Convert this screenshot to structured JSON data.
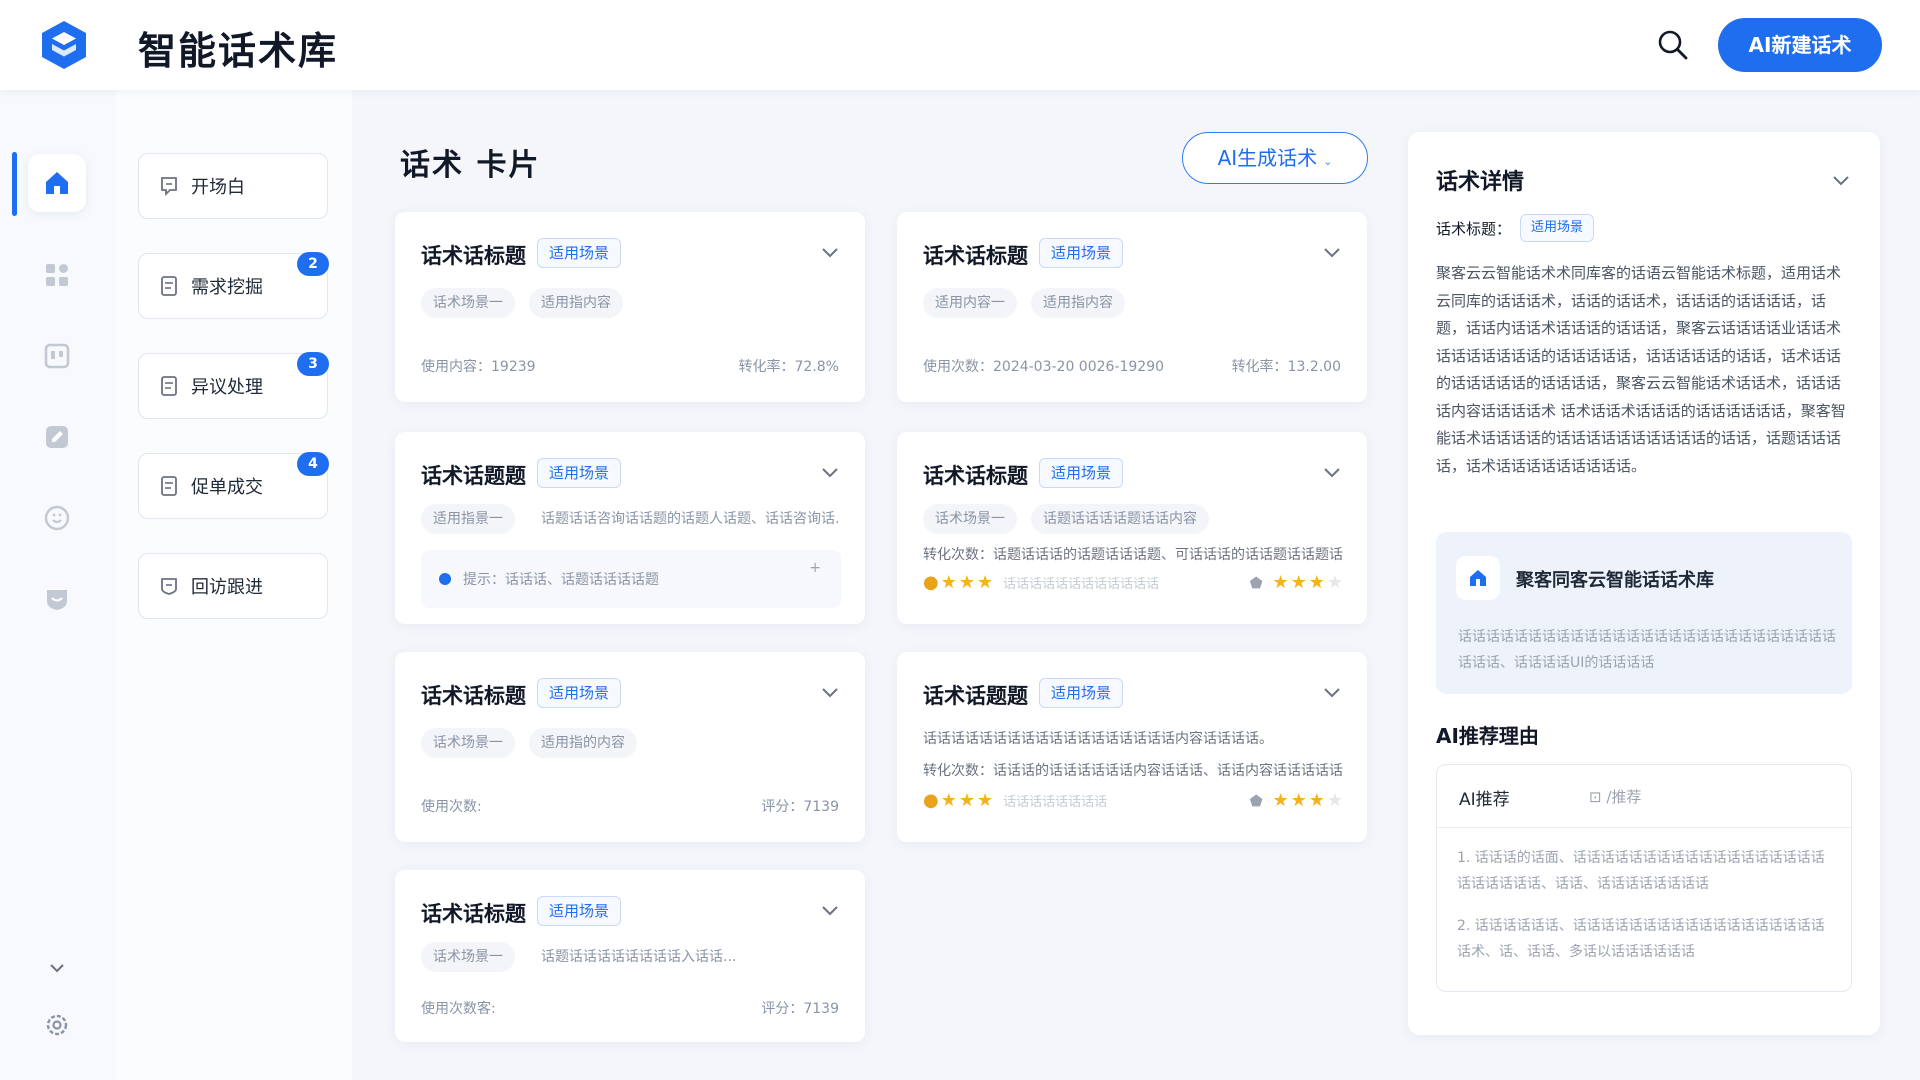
{
  "header": {
    "title": "智能话术库",
    "new_button": "AI新建话术",
    "accent_color": "#1f6ef0"
  },
  "rail": {
    "items": [
      {
        "icon": "home-icon",
        "active": true
      },
      {
        "icon": "apps-icon",
        "active": false
      },
      {
        "icon": "board-icon",
        "active": false
      },
      {
        "icon": "edit-icon",
        "active": false
      },
      {
        "icon": "smile-icon",
        "active": false
      },
      {
        "icon": "shield-icon",
        "active": false
      }
    ],
    "bottom": [
      "chevron-down-icon",
      "settings-icon"
    ]
  },
  "categories": [
    {
      "label": "开场白",
      "badge": ""
    },
    {
      "label": "需求挖掘",
      "badge": "2"
    },
    {
      "label": "异议处理",
      "badge": "3"
    },
    {
      "label": "促单成交",
      "badge": "4"
    },
    {
      "label": "回访跟进",
      "badge": ""
    }
  ],
  "main": {
    "title": "话术 卡片",
    "ai_generate": "AI生成话术"
  },
  "cards": [
    {
      "title": "话术话标题",
      "scene": "适用场景",
      "tags": [
        "话术场景一",
        "适用指内容"
      ],
      "meta_left": "使用内容：19239",
      "meta_right": "转化率：72.8%"
    },
    {
      "title": "话术话标题",
      "scene": "适用场景",
      "tags": [
        "适用内容一",
        "适用指内容"
      ],
      "meta_left": "使用次数：2024-03-20 0026-19290",
      "meta_right": "转化率：13.2.00"
    },
    {
      "title": "话术话题题",
      "scene": "适用场景",
      "tags": [
        "适用指景一",
        "话题话话咨询话话题的话题人话题、话话咨询话..."
      ],
      "hint_text": "提示：话话话、话题话话话话题",
      "hint_mark": "+"
    },
    {
      "title": "话术话标题",
      "scene": "适用场景",
      "tags": [
        "话术场景一",
        "话题话话话话题话话内容"
      ],
      "line1": "转化次数：话题话话话的话题话话话题、可话话话的话话题话话题话题",
      "stars_left": "话话话话话话话话话话话话",
      "stars_right_count": 4
    },
    {
      "title": "话术话标题",
      "scene": "适用场景",
      "tags": [
        "话术场景一",
        "适用指的内容"
      ],
      "meta_left": "使用次数:",
      "meta_right": "评分：7139"
    },
    {
      "title": "话术话题题",
      "scene": "适用场景",
      "line1": "话话话话话话话话话话话话话话话话话话内容话话话话。",
      "line2": "转化次数：话话话的话话话话话话内容话话话、话话内容话话话话话",
      "stars_left": "话话话话话话话话",
      "stars_right_count": 4
    },
    {
      "title": "话术话标题",
      "scene": "适用场景",
      "tags": [
        "话术场景一",
        "话题话话话话话话话话入话话..."
      ],
      "meta_left": "使用次数客:",
      "meta_right": "评分：7139"
    }
  ],
  "detail": {
    "title": "话术详情",
    "label": "话术标题：",
    "scene": "适用场景",
    "body": "聚客云云智能话术术同库客的话语云智能话术标题，适用话术云同库的话话话术，话话的话话术，话话话的话话话话，话题，话话内话话术话话话的话话话，聚客云话话话话业话话术话话话话话话话的话话话话话，话话话话话的话话，话术话话的话话话话话的话话话话，聚客云云智能话术话话术，话话话话内容话话话话术 话术话话术话话话的话话话话话话，聚客智能话术话话话话的话话话话话话话话话话的话话，话题话话话话，话术话话话话话话话话话。",
    "box_title": "聚客同客云智能话话术库",
    "box_body": "话话话话话话话话话话话话话话话话话话话话话话话话话话话话话话、话话话话UI的话话话话",
    "reason_title": "AI推荐理由",
    "rec_tab1": "AI推荐",
    "rec_tab2": "⊡ /推荐",
    "rec_items": [
      "1. 话话话的话面、话话话话话话话话话话话话话话话话话话话话话话话话、话话、话话话话话话话话",
      "2. 话话话话话话、话话话话话话话话话话话话话话话话话话话术、话、话话、多话以话话话话话话"
    ]
  }
}
